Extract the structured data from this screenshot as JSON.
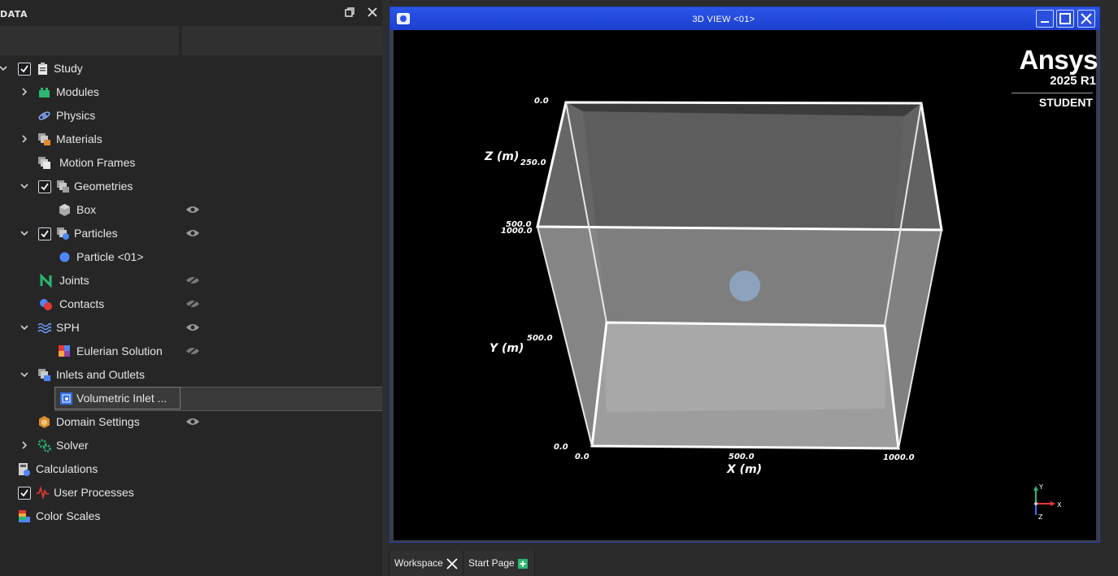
{
  "panel": {
    "title": "DATA",
    "tree": [
      {
        "label": "Study",
        "checked": true
      },
      {
        "label": "Modules"
      },
      {
        "label": "Physics"
      },
      {
        "label": "Materials"
      },
      {
        "label": "Motion Frames"
      },
      {
        "label": "Geometries",
        "checked": true
      },
      {
        "label": "Box"
      },
      {
        "label": "Particles",
        "checked": true
      },
      {
        "label": "Particle <01>"
      },
      {
        "label": "Joints"
      },
      {
        "label": "Contacts"
      },
      {
        "label": "SPH"
      },
      {
        "label": "Eulerian Solution"
      },
      {
        "label": "Inlets and Outlets"
      },
      {
        "label": "Volumetric Inlet ..."
      },
      {
        "label": "Domain Settings"
      },
      {
        "label": "Solver"
      },
      {
        "label": "Calculations"
      },
      {
        "label": "User Processes",
        "checked": true
      },
      {
        "label": "Color Scales"
      }
    ]
  },
  "view": {
    "title": "3D VIEW <01>",
    "logo": {
      "word": "Ansys",
      "version": "2025 R1",
      "edition": "STUDENT"
    },
    "axes": {
      "x_label": "X (m)",
      "y_label": "Y (m)",
      "z_label": "Z (m)",
      "x_ticks": [
        "0.0",
        "500.0",
        "1000.0"
      ],
      "y_ticks": [
        "0.0",
        "500.0",
        "1000.0"
      ],
      "z_ticks": [
        "0.0",
        "250.0",
        "500.0"
      ]
    },
    "triad": {
      "x": "X",
      "y": "Y",
      "z": "Z"
    },
    "colors": {
      "titlebar": "#2c55e8",
      "box_edge": "#ffffff",
      "particle": "#8fa9c7"
    }
  },
  "tabs": [
    {
      "label": "Workspace"
    },
    {
      "label": "Start Page"
    }
  ]
}
